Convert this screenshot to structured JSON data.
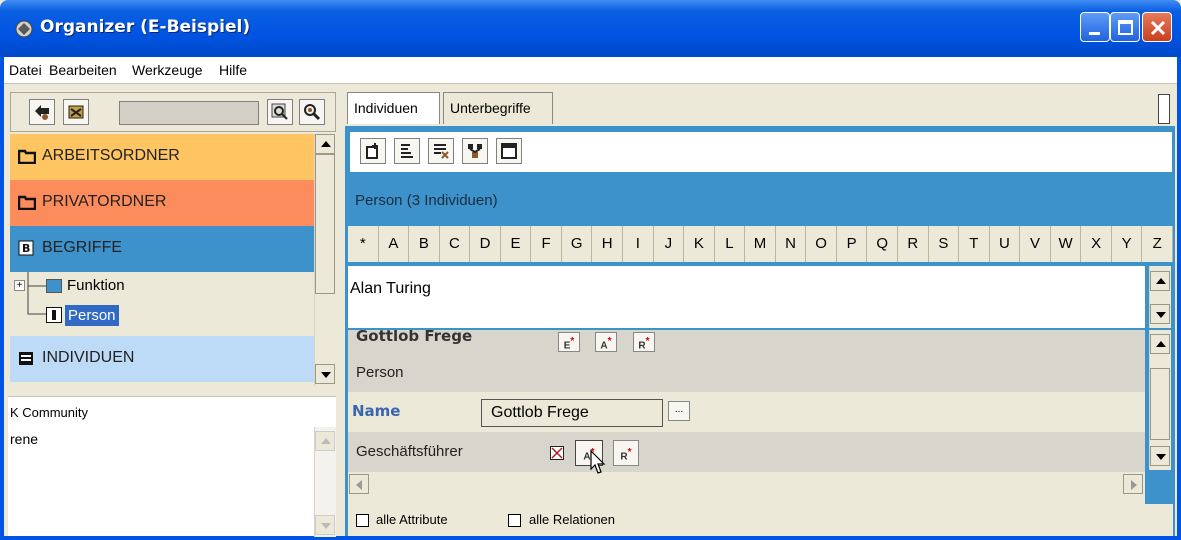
{
  "window": {
    "title": "Organizer (E-Beispiel)"
  },
  "menu": [
    "Datei",
    "Bearbeiten",
    "Werkzeuge",
    "Hilfe"
  ],
  "tree": {
    "categories": [
      "ARBEITSORDNER",
      "PRIVATORDNER",
      "BEGRIFFE",
      "INDIVIDUEN"
    ],
    "children": [
      "Funktion",
      "Person"
    ]
  },
  "community": {
    "header": "K Community",
    "user": "rene"
  },
  "tabs": [
    "Individuen",
    "Unterbegriffe"
  ],
  "panel_title": "Person (3 Individuen)",
  "alphabet": [
    "*",
    "A",
    "B",
    "C",
    "D",
    "E",
    "F",
    "G",
    "H",
    "I",
    "J",
    "K",
    "L",
    "M",
    "N",
    "O",
    "P",
    "Q",
    "R",
    "S",
    "T",
    "U",
    "V",
    "W",
    "X",
    "Y",
    "Z"
  ],
  "list": [
    "Alan Turing"
  ],
  "detail": {
    "header": "Gottlob Frege",
    "type": "Person",
    "name_label": "Name",
    "name_value": "Gottlob Frege",
    "ellipsis": "...",
    "relation_label": "Geschäftsführer",
    "button_e": "E",
    "button_a": "A",
    "button_r": "R",
    "star": "*"
  },
  "checkboxes": {
    "attributes": "alle Attribute",
    "relations": "alle Relationen"
  },
  "colors": {
    "arbeitsordner": "#fec562",
    "privatordner": "#fc8c5c",
    "begriffe": "#3d92cc",
    "individuen": "#bddbf6",
    "selection": "#316ac5"
  }
}
